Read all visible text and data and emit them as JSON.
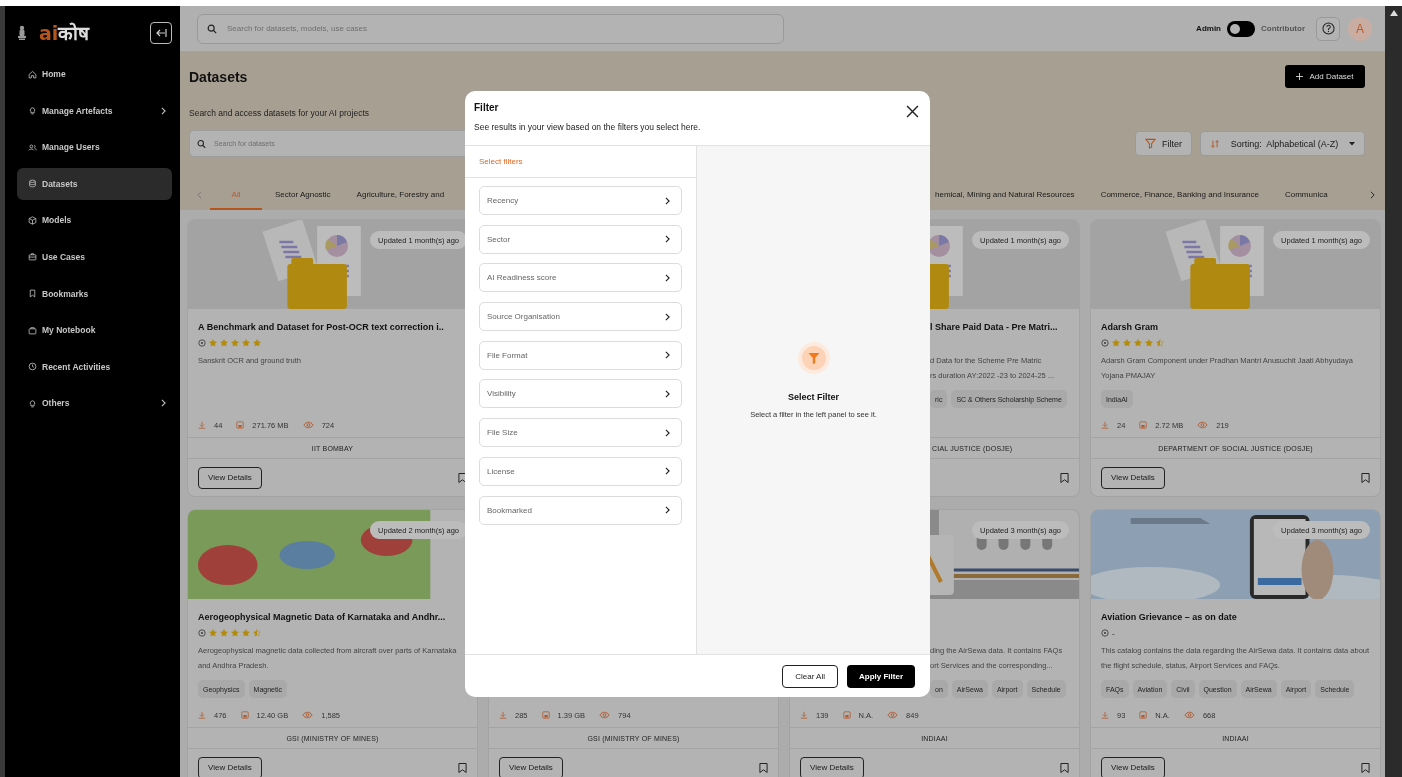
{
  "sidebar": {
    "logo": {
      "accent": "ai",
      "rest": "कोष"
    },
    "items": [
      {
        "label": "Home",
        "selected": false,
        "has_submenu": false
      },
      {
        "label": "Manage Artefacts",
        "selected": false,
        "has_submenu": true
      },
      {
        "label": "Manage Users",
        "selected": false,
        "has_submenu": false
      },
      {
        "label": "Datasets",
        "selected": true,
        "has_submenu": false
      },
      {
        "label": "Models",
        "selected": false,
        "has_submenu": false
      },
      {
        "label": "Use Cases",
        "selected": false,
        "has_submenu": false
      },
      {
        "label": "Bookmarks",
        "selected": false,
        "has_submenu": false
      },
      {
        "label": "My Notebook",
        "selected": false,
        "has_submenu": false
      },
      {
        "label": "Recent Activities",
        "selected": false,
        "has_submenu": false
      },
      {
        "label": "Others",
        "selected": false,
        "has_submenu": true
      }
    ]
  },
  "header": {
    "search": {
      "placeholder": "Search for datasets, models, use cases"
    },
    "role_toggle": {
      "left": "Admin",
      "right": "Contributor",
      "on": false
    },
    "avatar": "A"
  },
  "page": {
    "title": "Datasets",
    "add_button": "Add Dataset",
    "subtitle": "Search and access datasets for your AI projects",
    "search": {
      "placeholder": "Search for datasets"
    },
    "filter_button": "Filter",
    "sort": {
      "label": "Sorting:",
      "value": "Alphabetical (A-Z)"
    },
    "tabs": [
      {
        "label": "All",
        "selected": true
      },
      {
        "label": "Sector Agnostic",
        "selected": false
      },
      {
        "label": "Agriculture, Forestry and",
        "selected": false
      },
      {
        "label": "hemical, Mining and Natural Resources",
        "selected": false
      },
      {
        "label": "Commerce, Finance, Banking and Insurance",
        "selected": false
      },
      {
        "label": "Communica",
        "selected": false
      }
    ]
  },
  "card_rows": [
    {
      "cards": [
        {
          "kind": "documents",
          "badge": "Updated 1 month(s) ago",
          "title": "A Benchmark and Dataset for Post-OCR text correction i..",
          "stars": 5,
          "description": "Sanskrit OCR and ground truth",
          "downloads": "44",
          "size": "271.76 MB",
          "views": "724",
          "org": "IIT BOMBAY",
          "button": "View Details",
          "bookmarked": false
        },
        {
          "kind": "documents",
          "badge": "Updated 1 month(s) ago",
          "title": "l Share Paid Data - Pre Matri...",
          "description": "d Data for the Scheme Pre Matric\nrs duration AY:2022 -23 to 2024-25 ...",
          "tags": [
            "ric",
            "SC & Others Scholarship Scheme"
          ],
          "org": "CIAL JUSTICE (DOSJE)",
          "bookmarked": false
        },
        {
          "kind": "documents",
          "badge": "Updated 1 month(s) ago",
          "title": "Adarsh Gram",
          "stars": 4.5,
          "description": "Adarsh Gram Component under Pradhan Mantri Anusuchit Jaati Abhyudaya Yojana PMAJAY",
          "tags": [
            "IndiaAI"
          ],
          "downloads": "24",
          "size": "2.72 MB",
          "views": "219",
          "org": "DEPARTMENT OF SOCIAL JUSTICE (DOSJE)",
          "button": "View Details",
          "bookmarked": false
        }
      ]
    },
    {
      "cards": [
        {
          "kind": "map",
          "badge": "Updated 2 month(s) ago",
          "title": "Aerogeophysical Magnetic Data of Karnataka and Andhr...",
          "stars": 4.5,
          "description": "Aerogeophysical magnetic data collected from aircraft over parts of Karnataka and Andhra Pradesh.",
          "tags": [
            "Geophysics",
            "Magnetic"
          ],
          "downloads": "476",
          "size": "12.40 GB",
          "views": "1,585",
          "org": "GSI (MINISTRY OF MINES)",
          "button": "View Details",
          "bookmarked": false
        },
        {
          "downloads": "285",
          "size": "1.39 GB",
          "views": "794",
          "org": "GSI (MINISTRY OF MINES)",
          "button": "View Details",
          "bookmarked": false
        },
        {
          "kind": "airplane",
          "badge": "Updated 3 month(s) ago",
          "description": "ding the AirSewa data. It contains FAQs\nort Services and the corresponding...",
          "tags": [
            "on",
            "AirSewa",
            "Airport",
            "Schedule"
          ],
          "downloads": "139",
          "size": "N.A.",
          "views": "849",
          "org": "INDIAAI",
          "button": "View Details",
          "bookmarked": false
        },
        {
          "kind": "phone",
          "badge": "Updated 3 month(s) ago",
          "title": "Aviation Grievance – as on date",
          "rating_text": "-",
          "description": "This catalog contains the data regarding the AirSewa data. It contains data about the flight schedule, status, Airport Services and FAQs.",
          "tags": [
            "FAQs",
            "Aviation",
            "Civil",
            "Question",
            "AirSewa",
            "Airport",
            "Schedule"
          ],
          "downloads": "93",
          "size": "N.A.",
          "views": "668",
          "org": "INDIAAI",
          "button": "View Details",
          "bookmarked": false
        }
      ]
    }
  ],
  "filter_dialog": {
    "title": "Filter",
    "subtitle": "See results in your view based on the filters you select here.",
    "section_label": "Select filters",
    "filters": [
      {
        "label": "Recency",
        "selected": false
      },
      {
        "label": "Sector",
        "selected": false
      },
      {
        "label": "AI Readiness score",
        "selected": false
      },
      {
        "label": "Source Organisation",
        "selected": false
      },
      {
        "label": "File Format",
        "selected": false
      },
      {
        "label": "Visibility",
        "selected": false
      },
      {
        "label": "File Size",
        "selected": false
      },
      {
        "label": "License",
        "selected": false
      },
      {
        "label": "Bookmarked",
        "selected": false
      }
    ],
    "empty_state": {
      "title": "Select Filter",
      "text": "Select a filter in the left panel to see it."
    },
    "buttons": {
      "clear": "Clear All",
      "apply": "Apply Filter"
    }
  }
}
